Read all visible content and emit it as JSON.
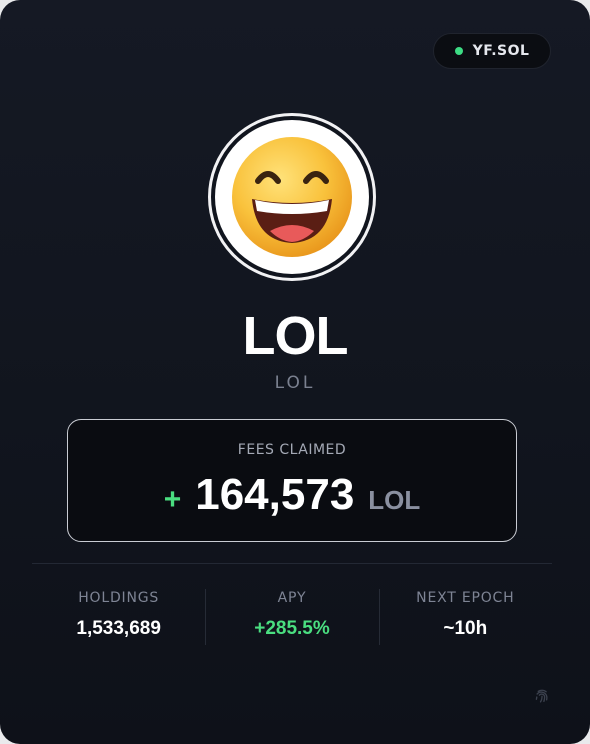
{
  "network_badge": {
    "label": "YF.SOL",
    "status_color": "#3ddc84"
  },
  "token": {
    "avatar_icon": "grinning-face-emoji",
    "name": "LOL",
    "symbol": "LOL"
  },
  "fees": {
    "label": "FEES CLAIMED",
    "sign": "+",
    "amount": "164,573",
    "unit": "LOL"
  },
  "stats": [
    {
      "label": "HOLDINGS",
      "value": "1,533,689"
    },
    {
      "label": "APY",
      "value": "+285.5%",
      "color": "#4ade80"
    },
    {
      "label": "NEXT EPOCH",
      "value": "~10h"
    }
  ],
  "footer": {
    "icon": "fingerprint-icon"
  },
  "colors": {
    "accent_green": "#4ade80",
    "card_bg": "#11151e",
    "text_muted": "#7b8190"
  }
}
